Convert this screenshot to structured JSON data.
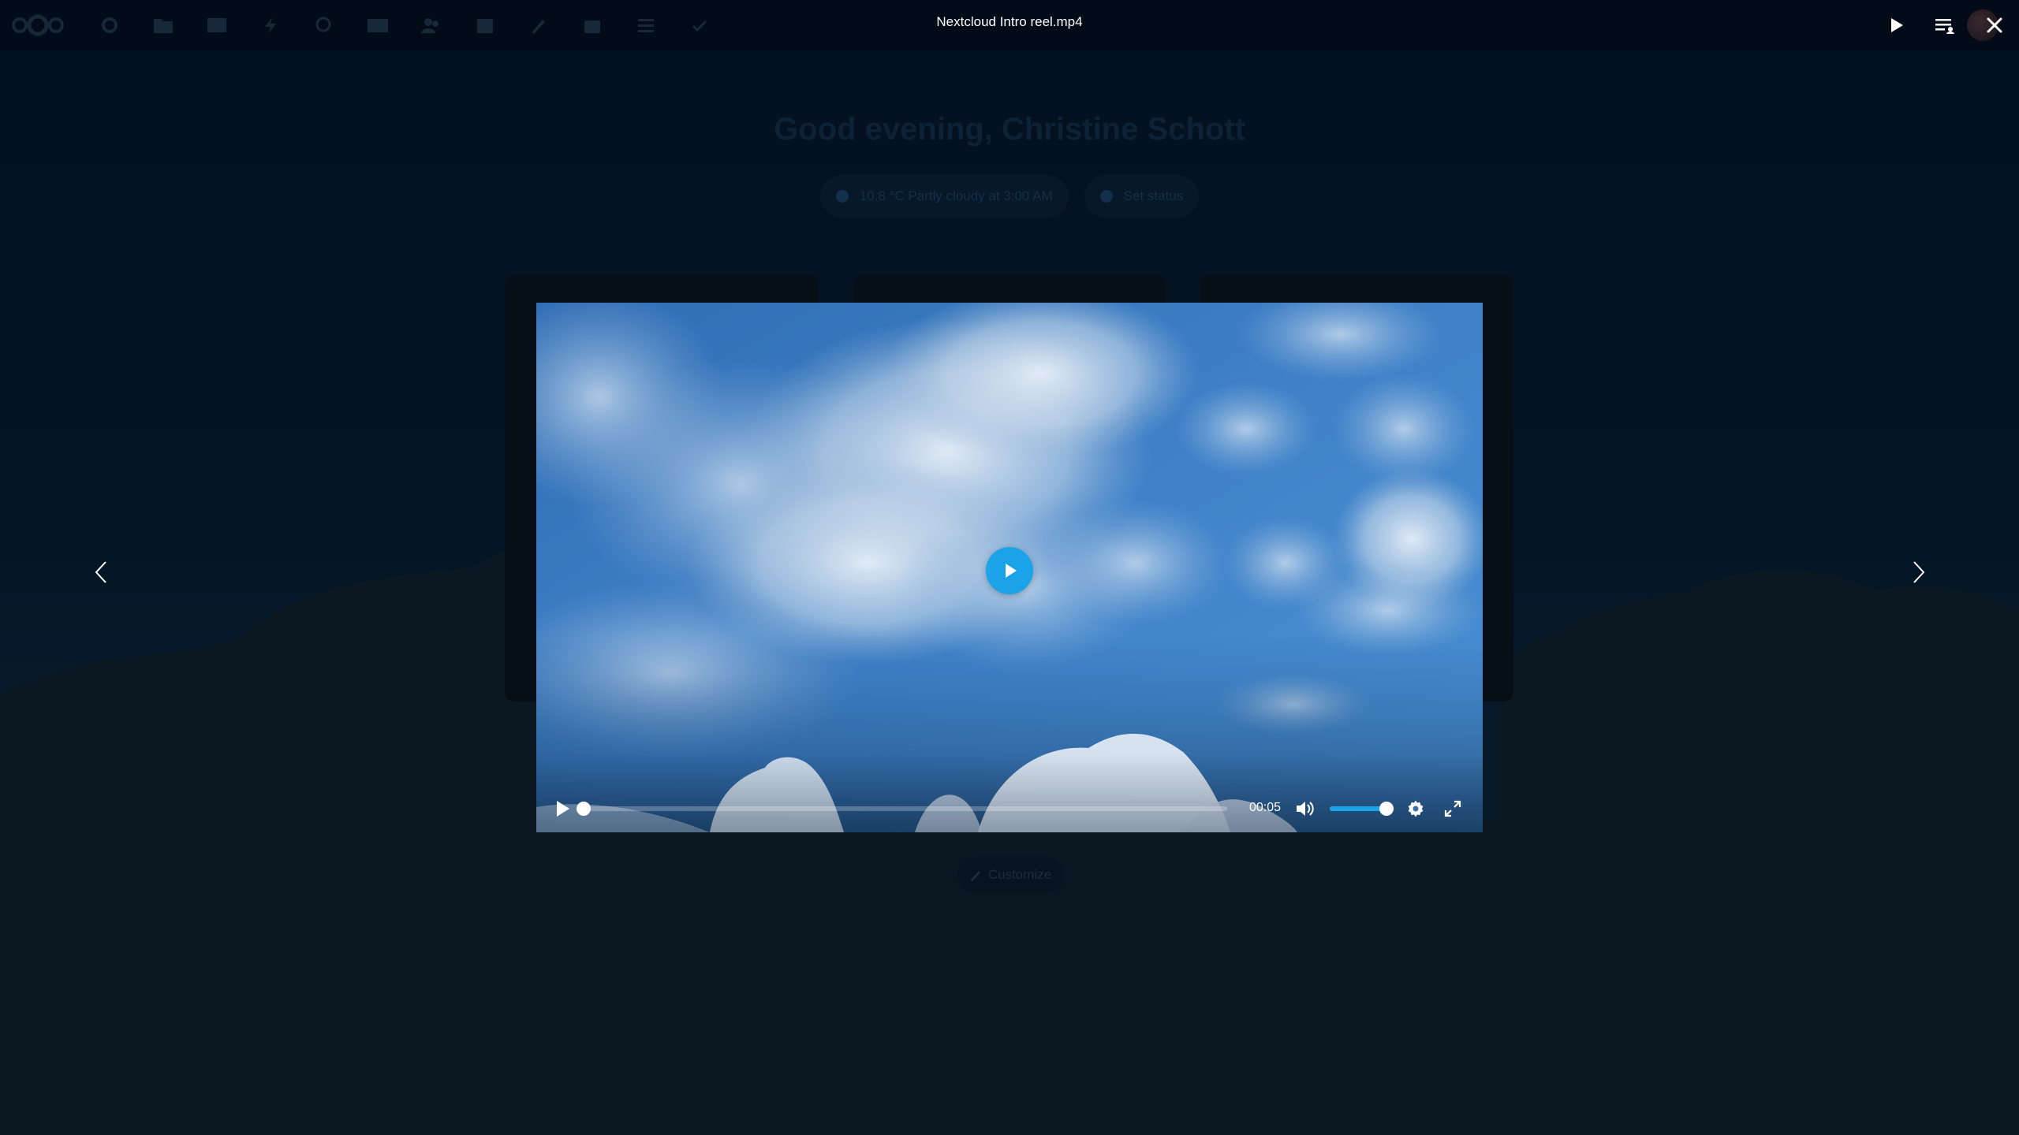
{
  "viewer": {
    "title": "Nextcloud Intro reel.mp4"
  },
  "background": {
    "greeting": "Good evening, Christine Schott",
    "weather": "10.8 °C Partly cloudy at 3:00 AM",
    "set_status": "Set status",
    "customize": "Customize"
  },
  "video": {
    "time": "00:05",
    "progress_fraction": 0.0,
    "volume_fraction": 0.9
  },
  "colors": {
    "accent": "#1aa3e8",
    "overlay": "#020a14",
    "sky": "#3a7bc2"
  },
  "icons": {
    "app_menu": [
      "nextcloud-logo-icon",
      "dashboard-icon",
      "files-icon",
      "photos-icon",
      "activity-icon",
      "search-icon",
      "mail-icon",
      "contacts-icon",
      "calendar-icon",
      "notes-icon",
      "deck-icon",
      "tasks-icon",
      "more-icon"
    ],
    "header": [
      "slideshow-play-icon",
      "sidebar-toggle-icon",
      "close-icon"
    ]
  }
}
